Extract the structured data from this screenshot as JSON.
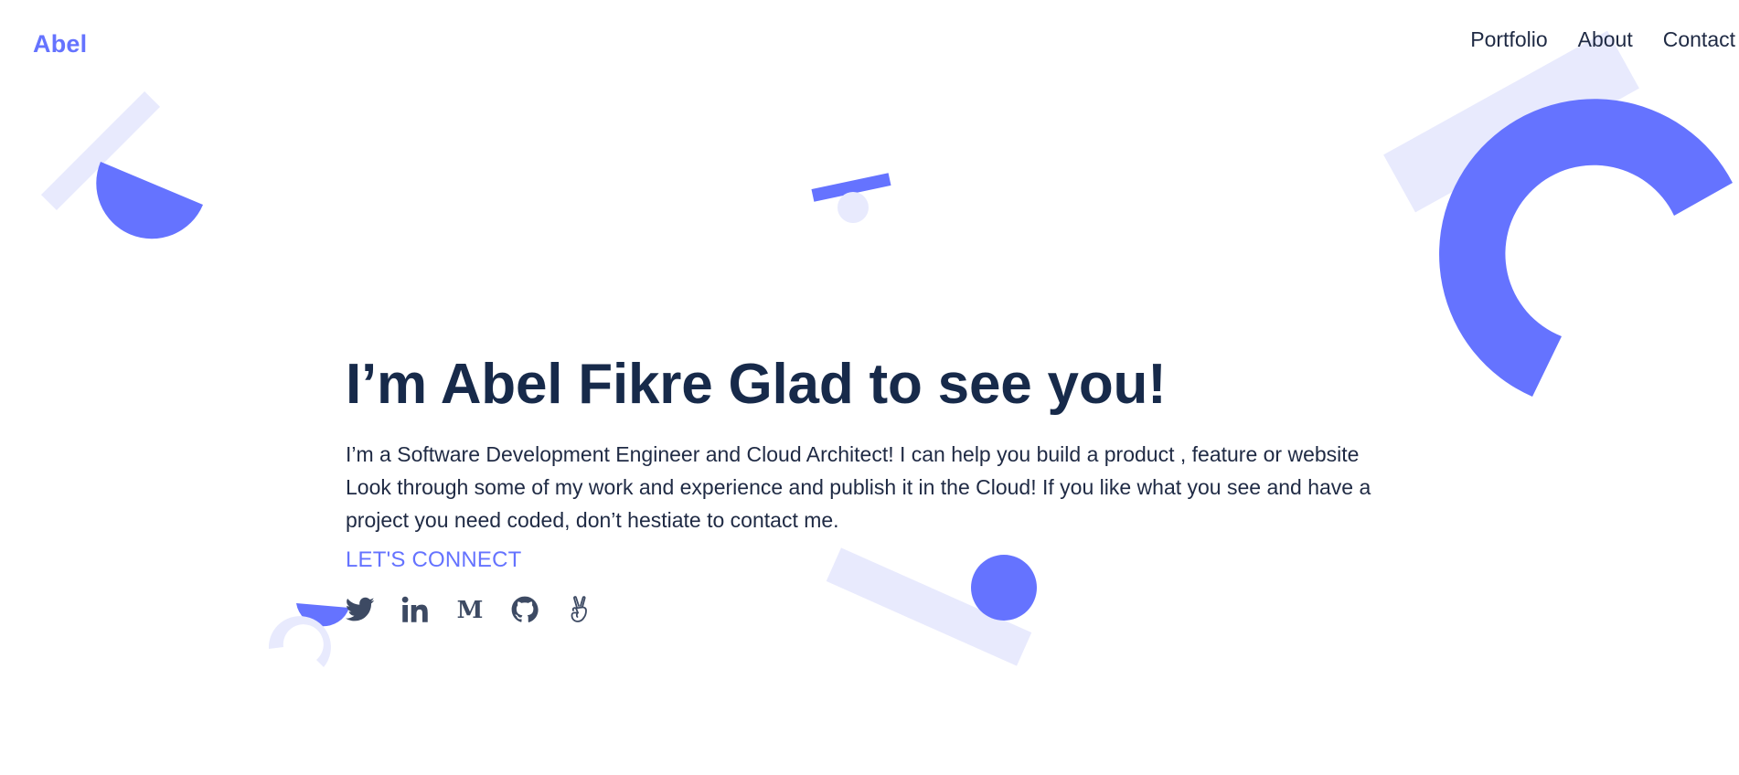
{
  "header": {
    "logo": "Abel",
    "nav": [
      {
        "label": "Portfolio"
      },
      {
        "label": "About"
      },
      {
        "label": "Contact"
      }
    ]
  },
  "hero": {
    "heading": "I’m Abel Fikre Glad to see you!",
    "description": "I’m a Software Development Engineer and Cloud Architect! I can help you build a product , feature or website Look through some of my work and experience and publish it in the Cloud! If you like what you see and have a project you need coded, don’t hestiate to contact me.",
    "cta_label": "LET'S CONNECT"
  },
  "socials": [
    {
      "icon": "twitter-icon"
    },
    {
      "icon": "linkedin-icon"
    },
    {
      "icon": "medium-icon"
    },
    {
      "icon": "github-icon"
    },
    {
      "icon": "angellist-icon"
    }
  ],
  "colors": {
    "accent": "#6573ff",
    "accent_light": "#e8eafd",
    "heading": "#172a4a",
    "text": "#1f2a44",
    "icon": "#3d4a63"
  }
}
